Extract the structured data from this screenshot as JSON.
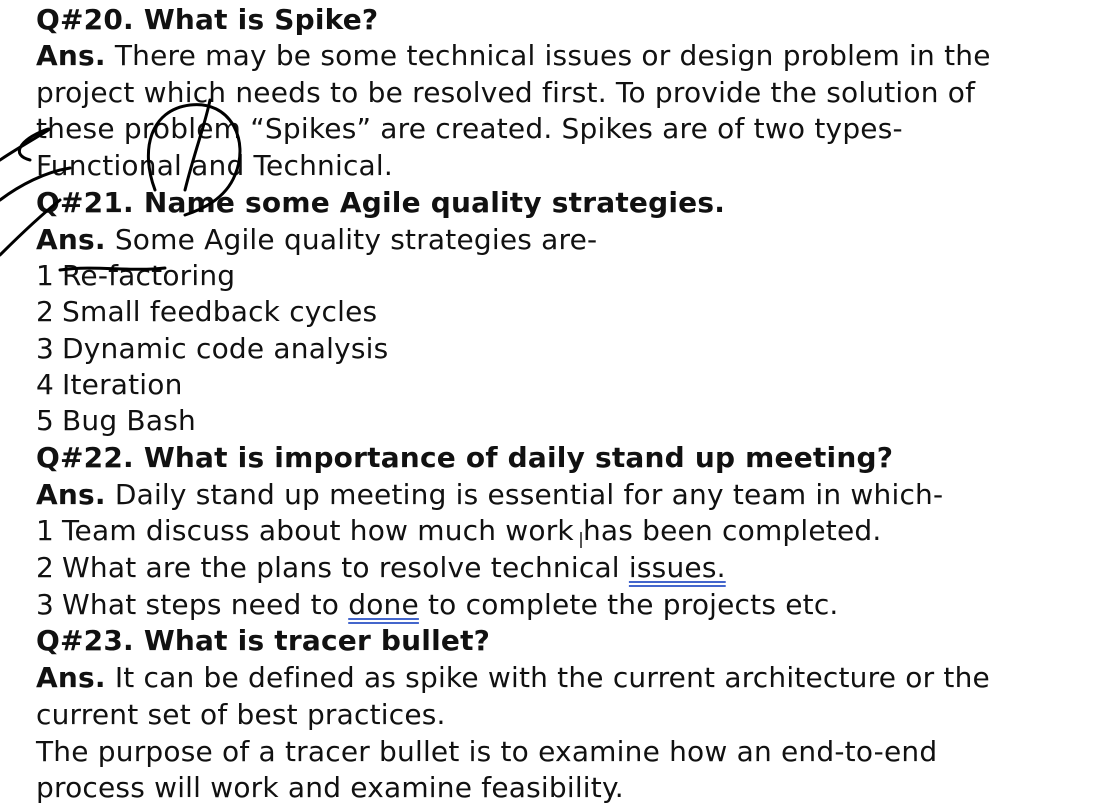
{
  "q20": {
    "title": "Q#20. What is Spike?",
    "ans_label": "Ans.",
    "line1": " There may be some technical issues or design problem in the",
    "line2": "project which needs to be resolved first. To provide the solution of",
    "line3": "these problem “Spikes” are created. Spikes are of two types-",
    "line4": "Functional and Technical."
  },
  "q21": {
    "title": "Q#21. Name some Agile quality strategies.",
    "ans_label": "Ans.",
    "intro": " Some Agile quality strategies are-",
    "items": [
      {
        "num": "1",
        "text": "Re-factoring"
      },
      {
        "num": "2",
        "text": "Small feedback cycles"
      },
      {
        "num": "3",
        "text": "Dynamic code analysis"
      },
      {
        "num": "4",
        "text": "Iteration"
      },
      {
        "num": "5",
        "text": "Bug Bash"
      }
    ]
  },
  "q22": {
    "title": "Q#22. What is importance of daily stand up meeting?",
    "ans_label": "Ans.",
    "intro": " Daily stand up meeting is essential for any team in which-",
    "items": [
      {
        "num": "1",
        "text": "Team discuss about how much work has been completed."
      },
      {
        "num": "2",
        "text_a": "What are the plans to resolve technical ",
        "text_b": "issues."
      },
      {
        "num": "3",
        "text_a": "What steps need to ",
        "text_b": "done",
        "text_c": " to complete the projects etc."
      }
    ]
  },
  "q23": {
    "title": "Q#23. What is tracer bullet?",
    "ans_label": "Ans.",
    "line1": " It can be defined as spike with the current architecture or the",
    "line2": "current set of best practices.",
    "line3": "The purpose of a tracer bullet is to examine how an end-to-end",
    "line4": "process will work and examine feasibility."
  }
}
